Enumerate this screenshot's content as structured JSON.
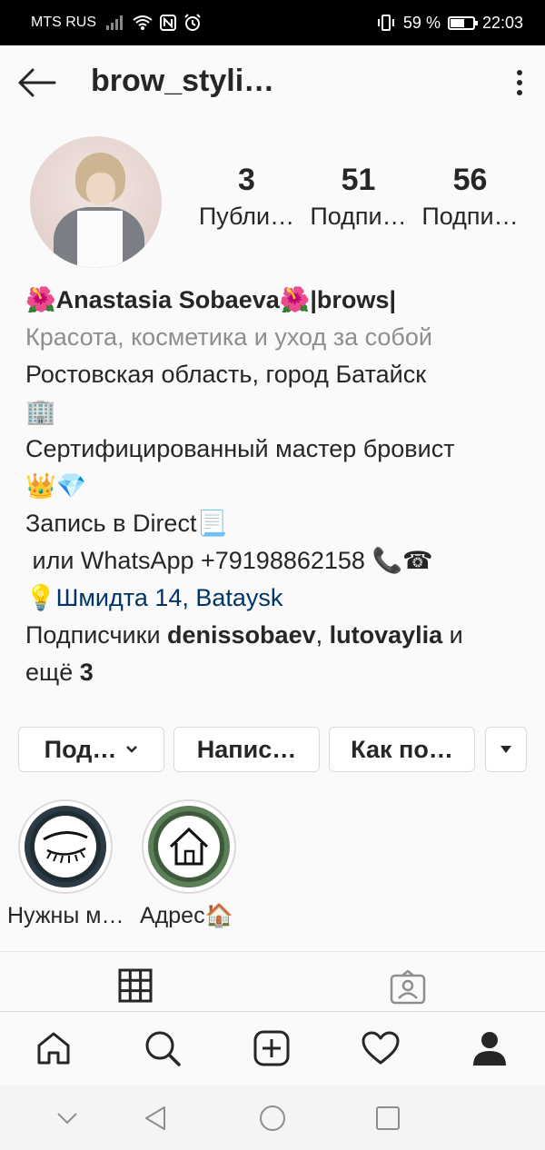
{
  "status_bar": {
    "carrier": "MTS RUS",
    "battery_percent": "59 %",
    "time": "22:03",
    "icons": [
      "signal-icon",
      "wifi-icon",
      "nfc-icon",
      "alarm-icon",
      "vibrate-icon",
      "battery-icon"
    ]
  },
  "header": {
    "username": "brow_styli…"
  },
  "stats": [
    {
      "count": "3",
      "label": "Публи…"
    },
    {
      "count": "51",
      "label": "Подпи…"
    },
    {
      "count": "56",
      "label": "Подпи…"
    }
  ],
  "bio": {
    "name_prefix_emoji": "🌺",
    "name_text": "Anastasia Sobaeva",
    "name_mid_emoji": "🌺",
    "name_suffix": "|brows|",
    "category": "Красота, косметика и уход за собой",
    "line1": "Ростовская область, город Батайск",
    "line1_emoji": "🏢",
    "line2": "Сертифицированный мастер бровист",
    "line2_emoji": "👑💎",
    "line3": "Запись в Direct",
    "line3_emoji": "📃",
    "line4": " или WhatsApp +79198862158 ",
    "line4_emoji": "📞☎",
    "address_emoji": "💡",
    "address": "Шмидта 14, Bataysk",
    "followers_prefix": "Подписчики ",
    "follower1": "denissobaev",
    "followers_sep": ", ",
    "follower2": "lutovaylia",
    "followers_mid": " и",
    "followers_more_prefix": "ещё ",
    "followers_more_count": "3"
  },
  "buttons": {
    "follow": "Под…",
    "message": "Напис…",
    "contact": "Как по…"
  },
  "highlights": [
    {
      "label": "Нужны м…"
    },
    {
      "label": "Адрес🏠"
    }
  ],
  "colors": {
    "text": "#262626",
    "muted": "#8e8e8e",
    "link": "#003569",
    "border": "#dbdbdb"
  }
}
